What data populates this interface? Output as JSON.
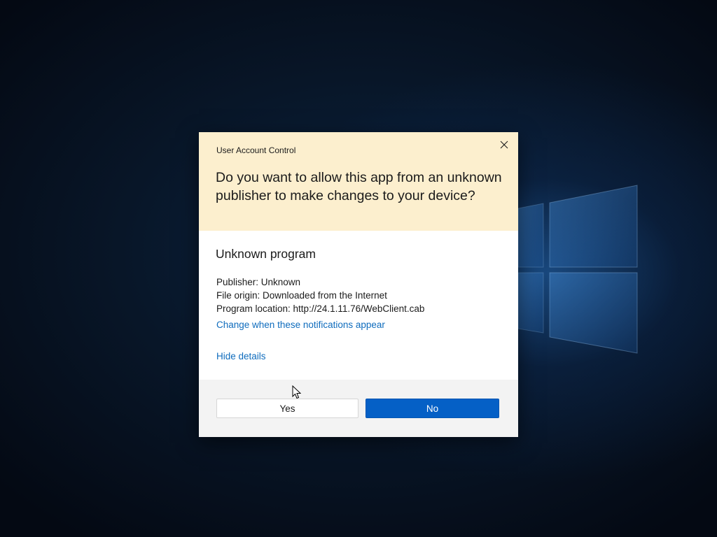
{
  "dialog": {
    "title": "User Account Control",
    "question": "Do you want to allow this app from an unknown publisher to make changes to your device?",
    "program_name": "Unknown program",
    "details": {
      "publisher": "Publisher: Unknown",
      "file_origin": "File origin: Downloaded from the Internet",
      "program_location": "Program location: http://24.1.11.76/WebClient.cab"
    },
    "change_notifications_link": "Change when these notifications appear",
    "hide_details_link": "Hide details",
    "buttons": {
      "yes": "Yes",
      "no": "No"
    },
    "close_icon": "close-icon"
  },
  "colors": {
    "header_background": "#fcefce",
    "link": "#0f6cbd",
    "primary_button": "#0560c6",
    "footer_background": "#f3f3f3"
  }
}
